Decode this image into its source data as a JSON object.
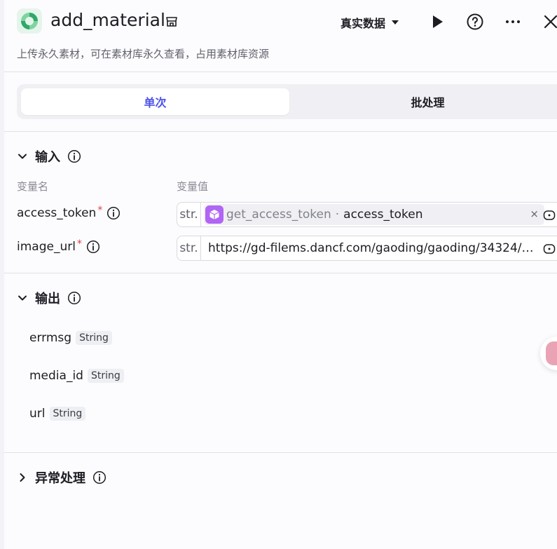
{
  "header": {
    "title": "add_material",
    "description": "上传永久素材，可在素材库永久查看，占用素材库资源",
    "mode_label": "真实数据"
  },
  "tabs": [
    {
      "label": "单次",
      "active": true
    },
    {
      "label": "批处理",
      "active": false
    }
  ],
  "input_section": {
    "title": "输入",
    "col_name": "变量名",
    "col_value": "变量值",
    "params": [
      {
        "name": "access_token",
        "required_mark": "*",
        "type": "str.",
        "ref_node": "get_access_token",
        "ref_sep": "·",
        "ref_field": "access_token",
        "close": "×"
      },
      {
        "name": "image_url",
        "required_mark": "*",
        "type": "str.",
        "value": "https://gd-filems.dancf.com/gaoding/gaoding/34324/…"
      }
    ]
  },
  "output_section": {
    "title": "输出",
    "fields": [
      {
        "name": "errmsg",
        "type": "String"
      },
      {
        "name": "media_id",
        "type": "String"
      },
      {
        "name": "url",
        "type": "String"
      }
    ]
  },
  "error_section": {
    "title": "异常处理"
  },
  "colors": {
    "accent": "#4d53e8",
    "required": "#e53b3b",
    "ref_icon": "#b065f5",
    "logo": "#2fa868"
  }
}
